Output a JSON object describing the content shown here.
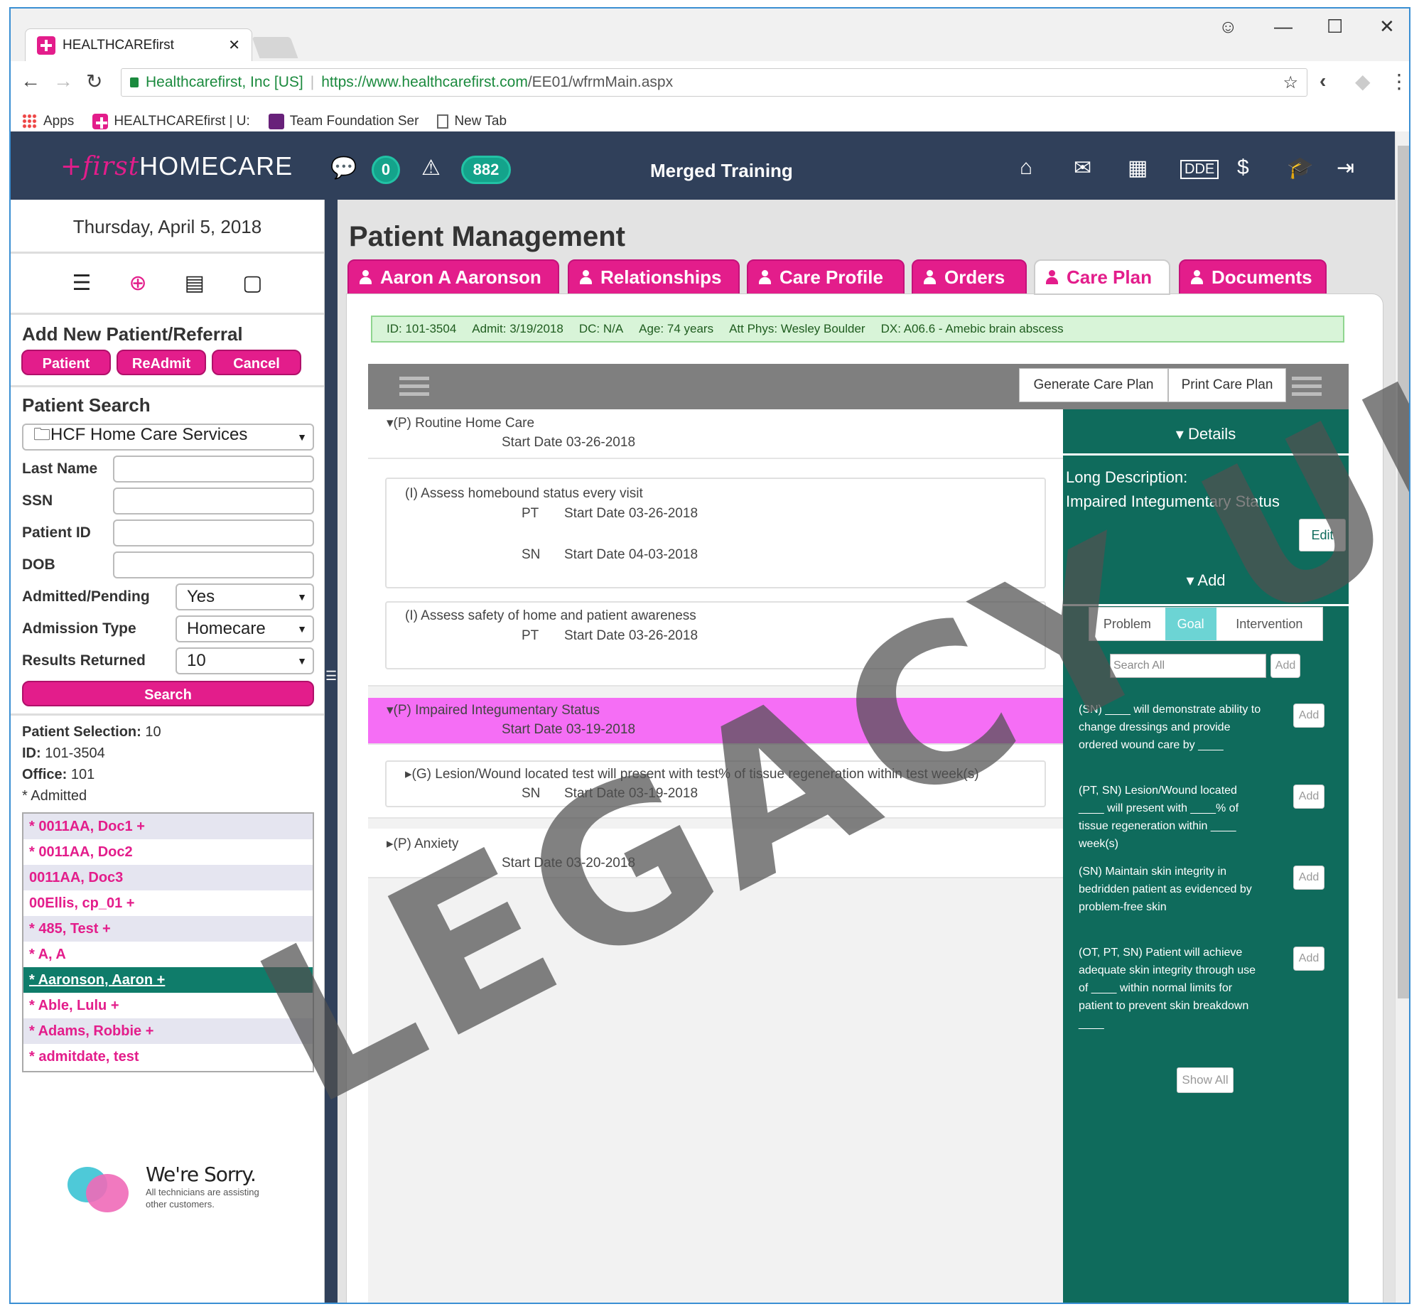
{
  "browser": {
    "tab_title": "HEALTHCAREfirst",
    "address_org": "Healthcarefirst, Inc [US]",
    "url_host": "https://www.healthcarefirst.com",
    "url_path": "/EE01/wfrmMain.aspx",
    "bookmarks": [
      "Apps",
      "HEALTHCAREfirst | U:",
      "Team Foundation Ser",
      "New Tab"
    ]
  },
  "header": {
    "brand_first": "+first",
    "brand_rest": "HOMECARE",
    "chat_count": "0",
    "alert_count": "882",
    "title": "Merged Training",
    "icons": [
      "home-icon",
      "mail-icon",
      "calendar-icon",
      "dde-icon",
      "billing-icon",
      "education-icon",
      "logout-icon"
    ]
  },
  "left": {
    "date": "Thursday, April 5, 2018",
    "add_title": "Add New Patient/Referral",
    "buttons": {
      "patient": "Patient",
      "readmit": "ReAdmit",
      "cancel": "Cancel"
    },
    "search_title": "Patient Search",
    "office": "HCF Home Care Services",
    "fields": {
      "last_name": "Last Name",
      "ssn": "SSN",
      "patient_id": "Patient ID",
      "dob": "DOB"
    },
    "admitted_label": "Admitted/Pending",
    "admitted_value": "Yes",
    "admission_type_label": "Admission Type",
    "admission_type_value": "Homecare",
    "results_label": "Results Returned",
    "results_value": "10",
    "search_button": "Search",
    "selection_label": "Patient Selection:",
    "selection_value": "10",
    "id_label": "ID:",
    "id_value": "101-3504",
    "office_label": "Office:",
    "office_value": "101",
    "admitted_note": "* Admitted",
    "patients": [
      "* 0011AA, Doc1 +",
      "* 0011AA, Doc2",
      "0011AA, Doc3",
      "00Ellis, cp_01 +",
      "* 485, Test +",
      "* A, A",
      "* Aaronson, Aaron +",
      "* Able, Lulu +",
      "* Adams, Robbie +",
      "* admitdate, test"
    ],
    "sorry_title": "We're Sorry.",
    "sorry_text": "All technicians are assisting other customers."
  },
  "main": {
    "title": "Patient Management",
    "tabs": [
      "Aaron A Aaronson",
      "Relationships",
      "Care Profile",
      "Orders",
      "Care Plan",
      "Documents"
    ],
    "info": {
      "id": "ID: 101-3504",
      "admit": "Admit: 3/19/2018",
      "dc": "DC: N/A",
      "age": "Age: 74 years",
      "phys_label": "Att Phys:",
      "phys": "Wesley Boulder",
      "dx": "DX: A06.6 - Amebic brain abscess"
    },
    "generate_btn": "Generate Care Plan",
    "print_btn": "Print Care Plan",
    "tree": {
      "p1": "▾(P) Routine Home Care",
      "p1_date": "Start Date 03-26-2018",
      "i1": "(I) Assess homebound status every visit",
      "i1_d1_disc": "PT",
      "i1_d1": "Start Date 03-26-2018",
      "i1_d2_disc": "SN",
      "i1_d2": "Start Date 04-03-2018",
      "i2": "(I) Assess safety of home and patient awareness",
      "i2_d1_disc": "PT",
      "i2_d1": "Start Date 03-26-2018",
      "p2": "▾(P) Impaired Integumentary Status",
      "p2_date": "Start Date 03-19-2018",
      "g1": "▸(G) Lesion/Wound located test will present with test% of tissue regeneration within test week(s)",
      "g1_disc": "SN",
      "g1_date": "Start Date 03-19-2018",
      "p3": "▸(P) Anxiety",
      "p3_date": "Start Date 03-20-2018"
    },
    "details": {
      "header": "▾ Details",
      "long_desc_label": "Long Description:",
      "long_desc": "Impaired Integumentary Status",
      "edit": "Edit",
      "add_header": "▾ Add",
      "tabs": [
        "Problem",
        "Goal",
        "Intervention"
      ],
      "search_placeholder": "Search All",
      "add": "Add",
      "goals": [
        "(SN) ____ will demonstrate ability to change dressings and provide ordered wound care by ____",
        "(PT, SN) Lesion/Wound located ____ will present with ____% of tissue regeneration within ____ week(s)",
        "(SN) Maintain skin integrity in bedridden patient as evidenced by problem-free skin",
        "(OT, PT, SN) Patient will achieve adequate skin integrity through use of ____ within normal limits for patient to prevent skin breakdown ____"
      ],
      "show_all": "Show All"
    }
  },
  "watermark": "LEGACY UI",
  "colors": {
    "brand_pink": "#e31d8b",
    "header_navy": "#30405a",
    "teal": "#0f6b5c",
    "badge_green": "#14a38b"
  }
}
